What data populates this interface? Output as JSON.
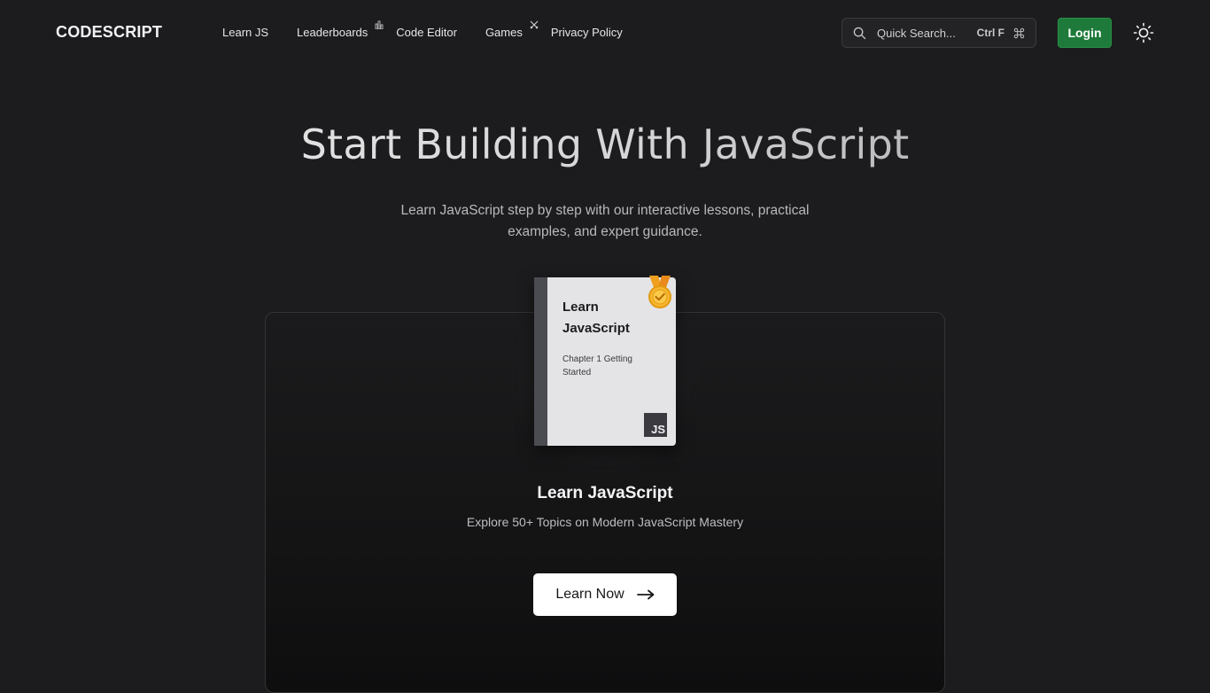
{
  "nav": {
    "logo": "CODESCRIPT",
    "links": [
      {
        "label": "Learn JS"
      },
      {
        "label": "Leaderboards",
        "icon": "bar-chart-icon"
      },
      {
        "label": "Code Editor"
      },
      {
        "label": "Games",
        "icon": "crossed-swords-icon"
      },
      {
        "label": "Privacy Policy"
      }
    ],
    "search": {
      "placeholder": "Quick Search...",
      "shortcut": "Ctrl F",
      "icon": "search-icon",
      "shortcut_icon": "command-icon"
    },
    "login_label": "Login",
    "theme_icon": "sun-icon"
  },
  "hero": {
    "title": "Start Building With JavaScript",
    "subtitle": "Learn JavaScript step by step with our interactive lessons, practical examples, and expert guidance."
  },
  "course": {
    "book": {
      "title": "Learn JavaScript",
      "chapter": "Chapter 1 Getting Started",
      "badge": "JS",
      "award_icon": "medal-icon"
    },
    "title": "Learn JavaScript",
    "description": "Explore 50+ Topics on Modern JavaScript Mastery",
    "cta_label": "Learn Now",
    "cta_icon": "arrow-right-icon"
  },
  "colors": {
    "background": "#1c1c1e",
    "login_green": "#1e7a3a",
    "medal_gold": "#f5a623"
  }
}
